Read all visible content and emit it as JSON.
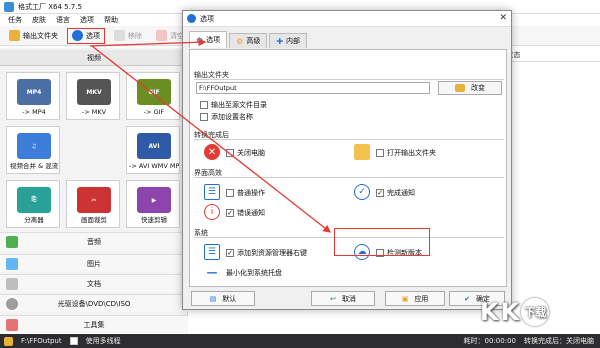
{
  "app": {
    "title": "格式工厂 X64 5.7.5",
    "menu": [
      "任务",
      "皮肤",
      "语言",
      "选项",
      "帮助"
    ],
    "toolbar": {
      "output_folder": "输出文件夹",
      "options": "选项",
      "remove": "移除",
      "clear_list": "清空列表"
    },
    "categories": {
      "video": "视频",
      "audio": "音频",
      "image": "图片",
      "document": "文档",
      "disc": "光驱设备\\DVD\\CD\\ISO",
      "tools": "工具集"
    },
    "tiles": [
      {
        "label": "-> MP4",
        "badge": "MP4",
        "color": "#4a6fa5"
      },
      {
        "label": "-> MKV",
        "badge": "MKV",
        "color": "#555555"
      },
      {
        "label": "-> GIF",
        "badge": "GIF",
        "color": "#6b8e23"
      },
      {
        "label": "视频合并 & 混流",
        "badge": "♫",
        "color": "#3b7dd8"
      },
      {
        "label": "-> AVI WMV MPG ...",
        "badge": "AVI",
        "color": "#2e5aa8"
      },
      {
        "label": "分离器",
        "badge": "⎘",
        "color": "#2aa198"
      },
      {
        "label": "画面裁剪",
        "badge": "✂",
        "color": "#cc3333"
      },
      {
        "label": "快速剪辑",
        "badge": "▶",
        "color": "#8e44ad"
      }
    ],
    "right_header": {
      "separator": "/",
      "convert_status": "转换状态"
    },
    "statusbar": {
      "path": "F:\\FFOutput",
      "multithread": "使用多线程",
      "elapsed": "耗时：00:00:00",
      "after_convert": "转换完成后：关闭电脑"
    }
  },
  "dialog": {
    "title": "选项",
    "close": "✕",
    "tabs": [
      "选项",
      "高级",
      "内部"
    ],
    "output_section": "输出文件夹",
    "output_path": "F:\\FFOutput",
    "change_button": "改变",
    "output_to_source": "输出至源文件目录",
    "add_setting_name": "添加设置名称",
    "after_section": "转换完成后",
    "shutdown": "关闭电脑",
    "open_output": "打开输出文件夹",
    "ui_section": "界面高效",
    "normal_op": "普通操作",
    "finish_notify": "完成通知",
    "error_notify": "错误通知",
    "system_section": "系统",
    "add_context_menu": "添加到资源管理器右键",
    "check_new_version": "检测新版本",
    "minimize_tray": "最小化到系统托盘",
    "buttons": {
      "default": "默认",
      "cancel": "取消",
      "apply": "应用",
      "ok": "确定"
    },
    "checked": {
      "output_to_source": false,
      "add_setting_name": false,
      "shutdown": false,
      "open_output": false,
      "normal_op": false,
      "finish_notify": true,
      "error_notify": true,
      "add_context_menu": true,
      "check_new_version": false
    }
  },
  "watermark": {
    "letters": [
      "K",
      "K",
      "下载"
    ]
  },
  "colors": {
    "accent_red": "#e53935",
    "blue": "#1e6fd9",
    "status_bar": "#2d2d30"
  }
}
